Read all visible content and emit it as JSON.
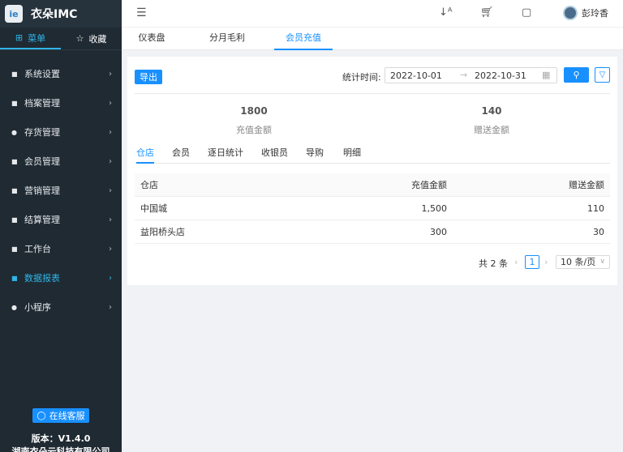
{
  "sidebar": {
    "brand": "衣朵IMC",
    "tabs": [
      {
        "label": "菜单",
        "icon": "grid-icon"
      },
      {
        "label": "收藏",
        "icon": "star-icon"
      }
    ],
    "items": [
      {
        "label": "系统设置"
      },
      {
        "label": "档案管理"
      },
      {
        "label": "存货管理"
      },
      {
        "label": "会员管理"
      },
      {
        "label": "营销管理"
      },
      {
        "label": "结算管理"
      },
      {
        "label": "工作台"
      },
      {
        "label": "数据报表",
        "active": true
      },
      {
        "label": "小程序"
      }
    ],
    "support": "在线客服",
    "version": "版本：V1.4.0",
    "company": "湖南衣朵云科技有限公司"
  },
  "header": {
    "user_name": "彭玲香"
  },
  "page_tabs": [
    "仪表盘",
    "分月毛利",
    "会员充值"
  ],
  "toolbar": {
    "export": "导出",
    "stat_label": "统计时间:",
    "date_start": "2022-10-01",
    "date_sep": "→",
    "date_end": "2022-10-31"
  },
  "stats": [
    {
      "value": "1800",
      "label": "充值金额"
    },
    {
      "value": "140",
      "label": "赠送金额"
    }
  ],
  "sub_tabs": [
    "仓店",
    "会员",
    "逐日统计",
    "收银员",
    "导购",
    "明细"
  ],
  "table": {
    "columns": [
      "仓店",
      "充值金额",
      "赠送金额"
    ],
    "rows": [
      [
        "中国城",
        "1,500",
        "110"
      ],
      [
        "益阳桥头店",
        "300",
        "30"
      ]
    ]
  },
  "pagination": {
    "total": "共 2 条",
    "current": "1",
    "page_size": "10 条/页"
  },
  "colors": {
    "accent": "#1890ff",
    "sidebar_bg": "#1f2a33",
    "sidebar_active": "#2fb5e8"
  }
}
